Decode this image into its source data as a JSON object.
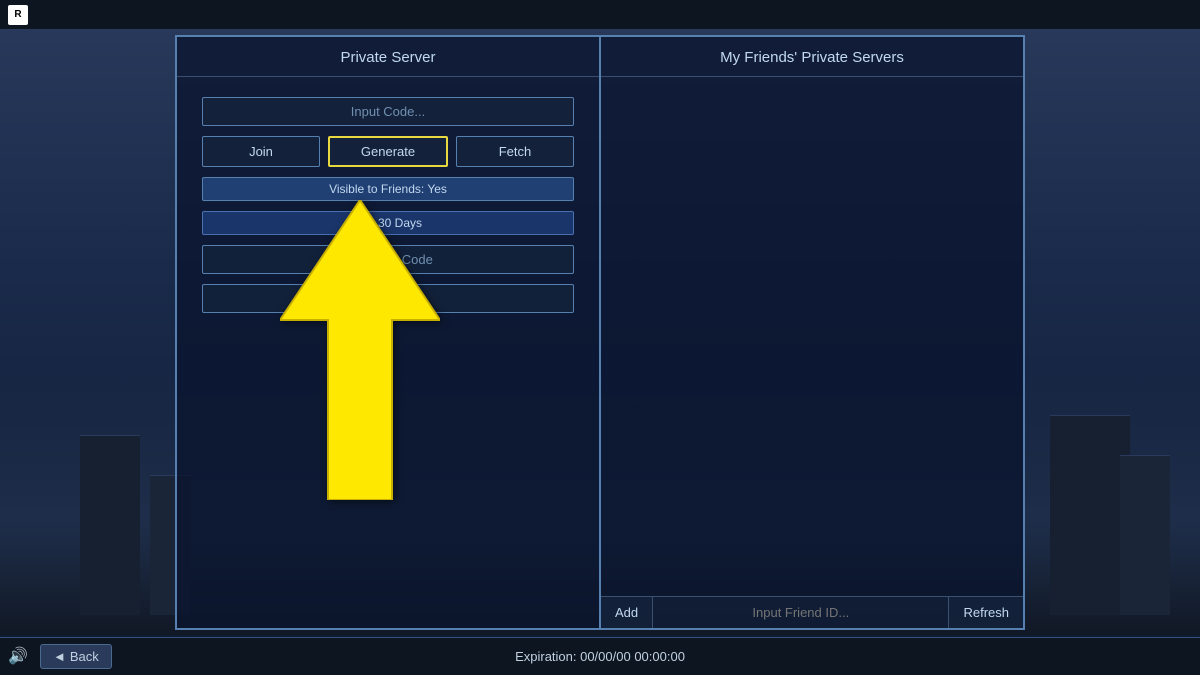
{
  "topbar": {
    "logo": "R"
  },
  "dialog": {
    "left_title": "Private Server",
    "right_title": "My Friends' Private Servers"
  },
  "private_server": {
    "input_code_placeholder": "Input Code...",
    "join_label": "Join",
    "generate_label": "Generate",
    "fetch_label": "Fetch",
    "visible_to_friends": "Visible to Friends: Yes",
    "buy_days": "Buy 30 Days",
    "input_key_placeholder": "Input Key Code",
    "empty_field_placeholder": ""
  },
  "friends_panel": {
    "add_label": "Add",
    "input_friend_placeholder": "Input Friend ID...",
    "refresh_label": "Refresh"
  },
  "bottombar": {
    "back_label": "Back",
    "expiration_text": "Expiration: 00/00/00 00:00:00"
  },
  "icons": {
    "back_icon": "◄",
    "volume_icon": "🔊"
  }
}
